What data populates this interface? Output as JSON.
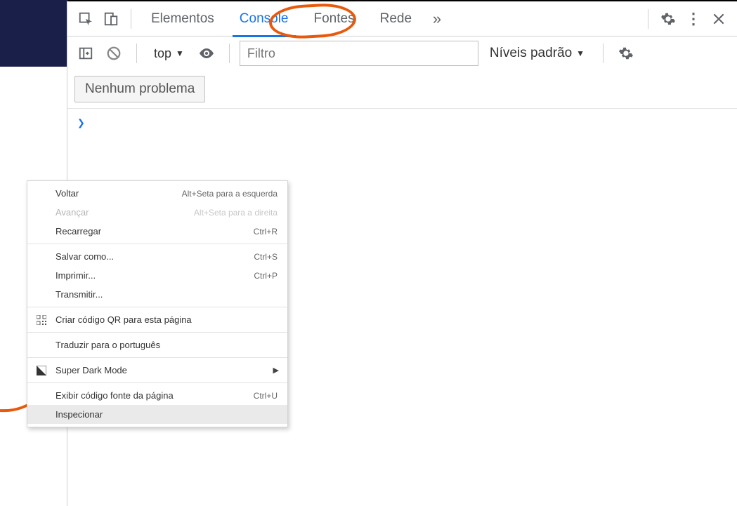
{
  "tabs": {
    "elements": "Elementos",
    "console": "Console",
    "sources": "Fontes",
    "network": "Rede"
  },
  "toolbar": {
    "context": "top",
    "filter_placeholder": "Filtro",
    "levels": "Níveis padrão"
  },
  "issues": {
    "label": "Nenhum problema"
  },
  "contextMenu": {
    "back": {
      "label": "Voltar",
      "shortcut": "Alt+Seta para a esquerda"
    },
    "forward": {
      "label": "Avançar",
      "shortcut": "Alt+Seta para a direita"
    },
    "reload": {
      "label": "Recarregar",
      "shortcut": "Ctrl+R"
    },
    "saveAs": {
      "label": "Salvar como...",
      "shortcut": "Ctrl+S"
    },
    "print": {
      "label": "Imprimir...",
      "shortcut": "Ctrl+P"
    },
    "cast": {
      "label": "Transmitir..."
    },
    "qr": {
      "label": "Criar código QR para esta página"
    },
    "translate": {
      "label": "Traduzir para o português"
    },
    "superDark": {
      "label": "Super Dark Mode"
    },
    "viewSource": {
      "label": "Exibir código fonte da página",
      "shortcut": "Ctrl+U"
    },
    "inspect": {
      "label": "Inspecionar"
    }
  }
}
